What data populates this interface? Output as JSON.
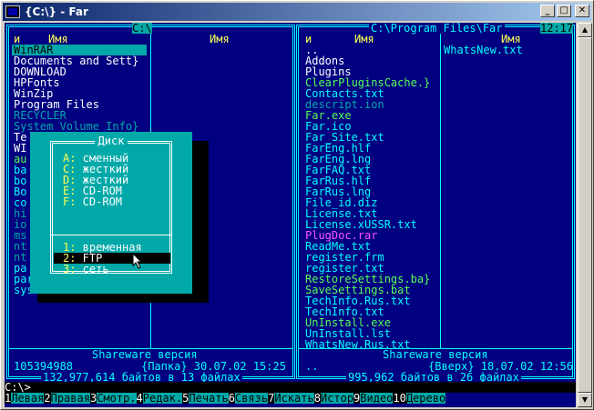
{
  "window": {
    "title": "{C:\\} - Far",
    "min": "_",
    "max": "□",
    "close": "✕"
  },
  "left_panel": {
    "header_path": "C:\\",
    "col1": "и",
    "col2": "Имя",
    "col3": "Имя",
    "files": [
      {
        "name": "WinRAR",
        "color": "white",
        "selected": true
      },
      {
        "name": "Documents and Sett}",
        "color": "white"
      },
      {
        "name": "DOWNLOAD",
        "color": "white"
      },
      {
        "name": "HPFonts",
        "color": "white"
      },
      {
        "name": "WinZip",
        "color": "white"
      },
      {
        "name": "Program Files",
        "color": "white"
      },
      {
        "name": "RECYCLER",
        "color": "gray"
      },
      {
        "name": "System Volume Info}",
        "color": "gray"
      },
      {
        "name": "Te",
        "color": "white"
      },
      {
        "name": "WI",
        "color": "white"
      },
      {
        "name": "au",
        "color": "green"
      },
      {
        "name": "ba",
        "color": "cyan"
      },
      {
        "name": "bo",
        "color": "cyan"
      },
      {
        "name": "Bo",
        "color": "cyan"
      },
      {
        "name": "co",
        "color": "cyan"
      },
      {
        "name": "hi",
        "color": "gray"
      },
      {
        "name": "io",
        "color": "gray"
      },
      {
        "name": "ms",
        "color": "gray"
      },
      {
        "name": "nt",
        "color": "gray"
      },
      {
        "name": "nt",
        "color": "gray"
      },
      {
        "name": "pa",
        "color": "cyan"
      },
      {
        "name": "param_s.tab",
        "color": "cyan"
      },
      {
        "name": "sysoc.inf",
        "color": "cyan"
      }
    ],
    "shareware": "Shareware версия",
    "status_left": "105394988",
    "status_right": "{Папка} 30.07.02 15:25",
    "summary": "132,977,614 байтов в 13 файлах"
  },
  "right_panel": {
    "header_path": "C:\\Program Files\\Far",
    "clock": "12:17",
    "col1": "и",
    "col2": "Имя",
    "col3": "Имя",
    "col_b_first": "WhatsNew.txt",
    "files": [
      {
        "name": "..",
        "color": "white"
      },
      {
        "name": "Addons",
        "color": "white"
      },
      {
        "name": "Plugins",
        "color": "white"
      },
      {
        "name": "ClearPluginsCache.}",
        "color": "green"
      },
      {
        "name": "Contacts.txt",
        "color": "cyan"
      },
      {
        "name": "descript.ion",
        "color": "gray"
      },
      {
        "name": "Far.exe",
        "color": "green"
      },
      {
        "name": "Far.ico",
        "color": "cyan"
      },
      {
        "name": "Far_Site.txt",
        "color": "cyan"
      },
      {
        "name": "FarEng.hlf",
        "color": "cyan"
      },
      {
        "name": "FarEng.lng",
        "color": "cyan"
      },
      {
        "name": "FarFAQ.txt",
        "color": "cyan"
      },
      {
        "name": "FarRus.hlf",
        "color": "cyan"
      },
      {
        "name": "FarRus.lng",
        "color": "cyan"
      },
      {
        "name": "File_id.diz",
        "color": "cyan"
      },
      {
        "name": "License.txt",
        "color": "cyan"
      },
      {
        "name": "License.xUSSR.txt",
        "color": "cyan"
      },
      {
        "name": "PlugDoc.rar",
        "color": "magenta"
      },
      {
        "name": "ReadMe.txt",
        "color": "cyan"
      },
      {
        "name": "register.frm",
        "color": "cyan"
      },
      {
        "name": "register.txt",
        "color": "cyan"
      },
      {
        "name": "RestoreSettings.ba}",
        "color": "green"
      },
      {
        "name": "SaveSettings.bat",
        "color": "green"
      },
      {
        "name": "TechInfo.Rus.txt",
        "color": "cyan"
      },
      {
        "name": "TechInfo.txt",
        "color": "cyan"
      },
      {
        "name": "UnInstall.exe",
        "color": "green"
      },
      {
        "name": "UnInstall.lst",
        "color": "cyan"
      },
      {
        "name": "WhatsNew.Rus.txt",
        "color": "cyan"
      }
    ],
    "shareware": "Shareware версия",
    "status_left": "..",
    "status_right": "{Вверх} 18.07.02 12:56",
    "summary": "995,962 байтов в 26 файлах"
  },
  "dialog": {
    "title": "Диск",
    "drives": [
      {
        "key": "A:",
        "label": " сменный"
      },
      {
        "key": "C:",
        "label": " жесткий"
      },
      {
        "key": "D:",
        "label": " жесткий"
      },
      {
        "key": "E:",
        "label": " CD-ROM"
      },
      {
        "key": "F:",
        "label": " CD-ROM"
      }
    ],
    "plugins": [
      {
        "key": "1:",
        "label": " временная"
      },
      {
        "key": "2:",
        "label": " FTP",
        "selected": true
      },
      {
        "key": "3:",
        "label": " сеть"
      }
    ]
  },
  "command_line": "C:\\>",
  "keybar": [
    {
      "num": "1",
      "label": "Левая "
    },
    {
      "num": "2",
      "label": "Правая"
    },
    {
      "num": "3",
      "label": "Смотр."
    },
    {
      "num": "4",
      "label": "Редак."
    },
    {
      "num": "5",
      "label": "Печать"
    },
    {
      "num": "6",
      "label": "Связь "
    },
    {
      "num": "7",
      "label": "Искать"
    },
    {
      "num": "8",
      "label": "Истор "
    },
    {
      "num": "9",
      "label": "Видео "
    },
    {
      "num": "10",
      "label": "Дерево"
    }
  ]
}
